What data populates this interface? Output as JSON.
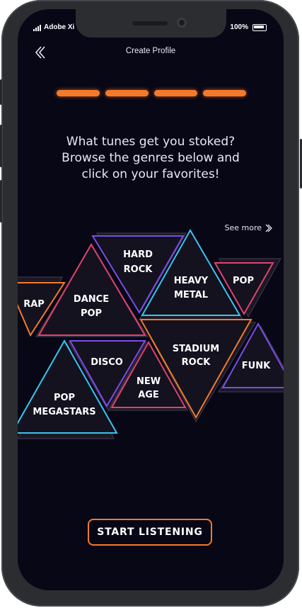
{
  "status_bar": {
    "carrier": "Adobe Xi",
    "battery": "100%"
  },
  "header": {
    "title": "Create Profile",
    "back_icon": "double-chevron-left-icon"
  },
  "progress": {
    "steps_total": 4,
    "steps_completed": 4,
    "color": "#f47a2a"
  },
  "prompt": {
    "line1": "What tunes get you stoked?",
    "line2": "Browse the genres below and",
    "line3": "click on your favorites!"
  },
  "see_more": {
    "label": "See more",
    "icon": "double-chevron-right-icon"
  },
  "genres": [
    {
      "id": "rap",
      "line1": "RAP",
      "line2": "",
      "color": "#f47a2a"
    },
    {
      "id": "dance-pop",
      "line1": "DANCE",
      "line2": "POP",
      "color": "#e2426f"
    },
    {
      "id": "hard-rock",
      "line1": "HARD",
      "line2": "ROCK",
      "color": "#7a4ce8"
    },
    {
      "id": "heavy-metal",
      "line1": "HEAVY",
      "line2": "METAL",
      "color": "#37c6f0"
    },
    {
      "id": "pop",
      "line1": "POP",
      "line2": "",
      "color": "#e2426f"
    },
    {
      "id": "disco",
      "line1": "DISCO",
      "line2": "",
      "color": "#7a4ce8"
    },
    {
      "id": "new-age",
      "line1": "NEW",
      "line2": "AGE",
      "color": "#e2426f"
    },
    {
      "id": "stadium-rock",
      "line1": "STADIUM",
      "line2": "ROCK",
      "color": "#f47a2a"
    },
    {
      "id": "funk",
      "line1": "FUNK",
      "line2": "",
      "color": "#7a4ce8"
    },
    {
      "id": "pop-megastars",
      "line1": "POP",
      "line2": "MEGASTARS",
      "color": "#37c6f0"
    }
  ],
  "cta": {
    "label": "START LISTENING",
    "color": "#f47a2a"
  }
}
